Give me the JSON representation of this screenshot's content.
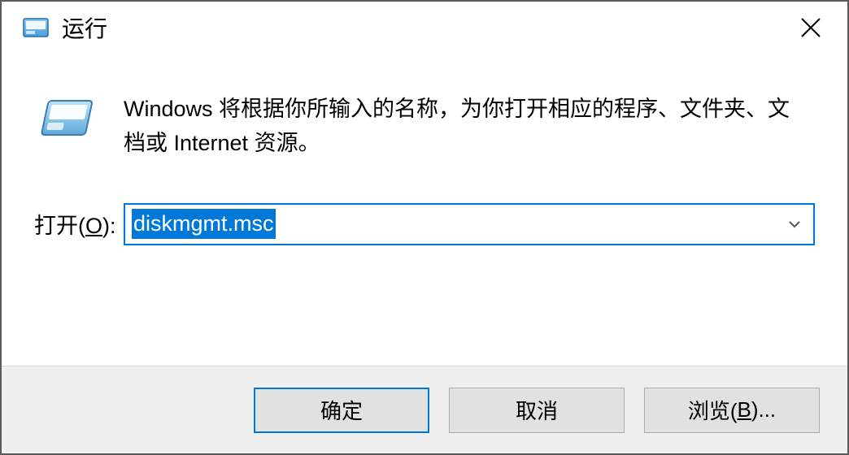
{
  "titlebar": {
    "title": "运行",
    "close_label": "Close"
  },
  "content": {
    "description": "Windows 将根据你所输入的名称，为你打开相应的程序、文件夹、文档或 Internet 资源。",
    "open_label_prefix": "打开(",
    "open_label_mnemonic": "O",
    "open_label_suffix": "):",
    "input_value": "diskmgmt.msc"
  },
  "buttons": {
    "ok": "确定",
    "cancel": "取消",
    "browse_prefix": "浏览(",
    "browse_mnemonic": "B",
    "browse_suffix": ")..."
  }
}
